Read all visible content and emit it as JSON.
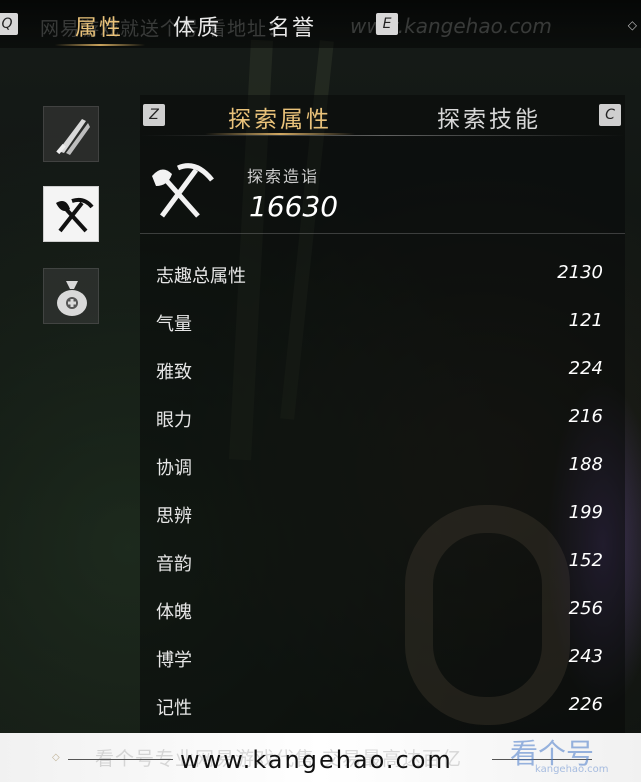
{
  "top_tabs": {
    "left_key": "Q",
    "right_key": "E",
    "items": [
      {
        "label": "属性",
        "active": true
      },
      {
        "label": "体质",
        "active": false
      },
      {
        "label": "名誉",
        "active": false
      }
    ]
  },
  "watermark": {
    "top_text": "网易游戏就送个号 看地址：",
    "top_url": "www.kangehao.com",
    "bottom_faint": "看个号专业网易游戏代售 交易最高达百亿",
    "bottom_url": "www.kangehao.com",
    "logo_text": "看个号",
    "logo_sub": "kangehao.com"
  },
  "sidebar": {
    "items": [
      {
        "name": "weapon-category",
        "icon": "sword-icon",
        "active": false
      },
      {
        "name": "explore-category",
        "icon": "shovel-pickaxe-icon",
        "active": true
      },
      {
        "name": "money-category",
        "icon": "money-bag-icon",
        "active": false
      }
    ]
  },
  "sub_tabs": {
    "left_key": "Z",
    "right_key": "C",
    "items": [
      {
        "label": "探索属性",
        "active": true
      },
      {
        "label": "探索技能",
        "active": false
      }
    ]
  },
  "skill": {
    "icon": "shovel-pickaxe-icon",
    "label": "探索造诣",
    "value": "16630"
  },
  "stats": [
    {
      "label": "志趣总属性",
      "value": "2130"
    },
    {
      "label": "气量",
      "value": "121"
    },
    {
      "label": "雅致",
      "value": "224"
    },
    {
      "label": "眼力",
      "value": "216"
    },
    {
      "label": "协调",
      "value": "188"
    },
    {
      "label": "思辨",
      "value": "199"
    },
    {
      "label": "音韵",
      "value": "152"
    },
    {
      "label": "体魄",
      "value": "256"
    },
    {
      "label": "博学",
      "value": "243"
    },
    {
      "label": "记性",
      "value": "226"
    }
  ],
  "colors": {
    "accent_gold": "#e9c27a",
    "text": "#e6e6e6"
  }
}
